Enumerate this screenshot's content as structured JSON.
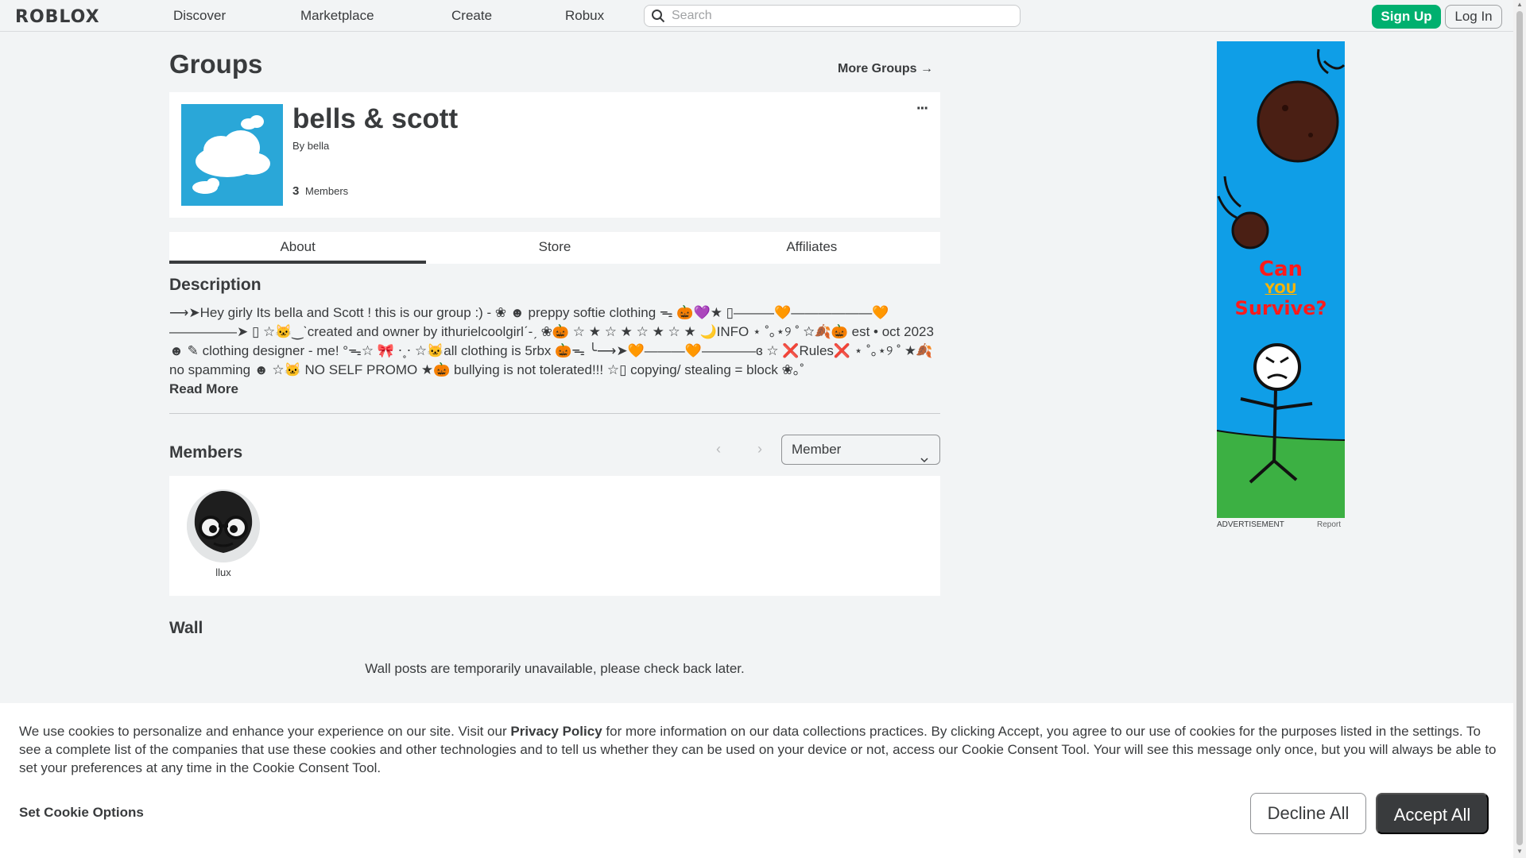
{
  "topbar": {
    "logo": "ROBLOX",
    "nav": [
      "Discover",
      "Marketplace",
      "Create",
      "Robux"
    ],
    "search_placeholder": "Search",
    "signup_label": "Sign Up",
    "login_label": "Log In"
  },
  "page": {
    "title": "Groups",
    "more_groups": "More Groups →"
  },
  "group": {
    "name": "bells & scott",
    "by_label": "By",
    "owner": "bella",
    "member_count": "3",
    "member_count_label": "Members"
  },
  "tabs": [
    "About",
    "Store",
    "Affiliates"
  ],
  "description": {
    "title": "Description",
    "text": "⟶➤Hey girly Its bella and Scott ! this is our group :) - ❀ ☻ preppy softie clothing ᯓ 🎃💜★ ▯———🧡——————🧡 —————➤ ▯ ☆🐱‿ˋcreated and owner by ithurielcoolgirlˊ-ˏ ❀🎃 ☆ ★ ☆ ★ ☆ ★ ☆ ★ 🌙INFO ⋆ ˚｡⋆୨ ˚ ☆🍂🎃 est • oct 2023☻ ✎ clothing designer - me! °ᯓ☆ 🎀 ⋅˳⋅ ☆🐱all clothing is 5rbx 🎃ᯓ ╰⟶➤🧡———🧡————ɞ ☆ ❌Rules❌ ⋆ ˚｡⋆୨ ˚ ★🍂 no spamming ☻ ☆🐱 NO SELF PROMO ★🎃 bullying is not tolerated!!! ☆▯ copying/ stealing = block ❀｡˚",
    "read_more": "Read More"
  },
  "members": {
    "title": "Members",
    "role_selected": "Member",
    "list": [
      {
        "name": "llux"
      }
    ]
  },
  "wall": {
    "title": "Wall",
    "message": "Wall posts are temporarily unavailable, please check back later."
  },
  "ad": {
    "headline_1": "Can",
    "headline_2": "YOU",
    "headline_3": "Survive?",
    "label": "ADVERTISEMENT",
    "report": "Report"
  },
  "cookie": {
    "text_before": "We use cookies to personalize and enhance your experience on our site. Visit our ",
    "privacy_link": "Privacy Policy",
    "text_after": " for more information on our data collections practices. By clicking Accept, you agree to our use of cookies for the purposes listed in the settings. To see a complete list of the companies that use these cookies and other technologies and to tell us whether they can be used on your device or not, access our Cookie Consent Tool. Your will see this message only once, but you will always be able to set your preferences at any time in the Cookie Consent Tool.",
    "options_label": "Set Cookie Options",
    "decline_label": "Decline All",
    "accept_label": "Accept All"
  },
  "colors": {
    "signup_green": "#00b06f",
    "accept_dark": "#393b3d",
    "ad_sky": "#0f9ee7",
    "ad_grass": "#3cb043",
    "ad_red_text": "#ff1a1a"
  }
}
